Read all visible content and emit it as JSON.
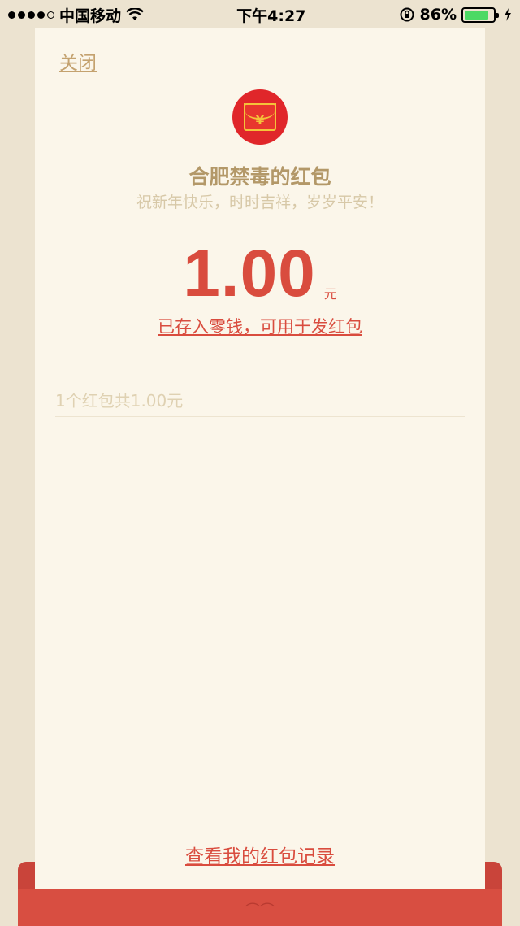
{
  "status_bar": {
    "carrier": "中国移动",
    "time": "下午4:27",
    "battery_percent": "86%",
    "battery_level": 0.86,
    "icons": [
      "signal-icon",
      "wifi-icon",
      "rotation-lock-icon",
      "battery-icon",
      "charging-icon"
    ]
  },
  "card": {
    "close_label": "关闭",
    "sender_title": "合肥禁毒的红包",
    "blessing": "祝新年快乐，时时吉祥，岁岁平安！",
    "amount": "1.00",
    "unit": "元",
    "stored_link": "已存入零钱，可用于发红包",
    "summary": "1个红包共1.00元",
    "records_link": "查看我的红包记录",
    "avatar_glyph": "¥"
  },
  "colors": {
    "accent_red": "#D94C3E",
    "gold": "#B39868",
    "card_bg": "#FBF6EA",
    "page_bg": "#ECE3D0"
  }
}
